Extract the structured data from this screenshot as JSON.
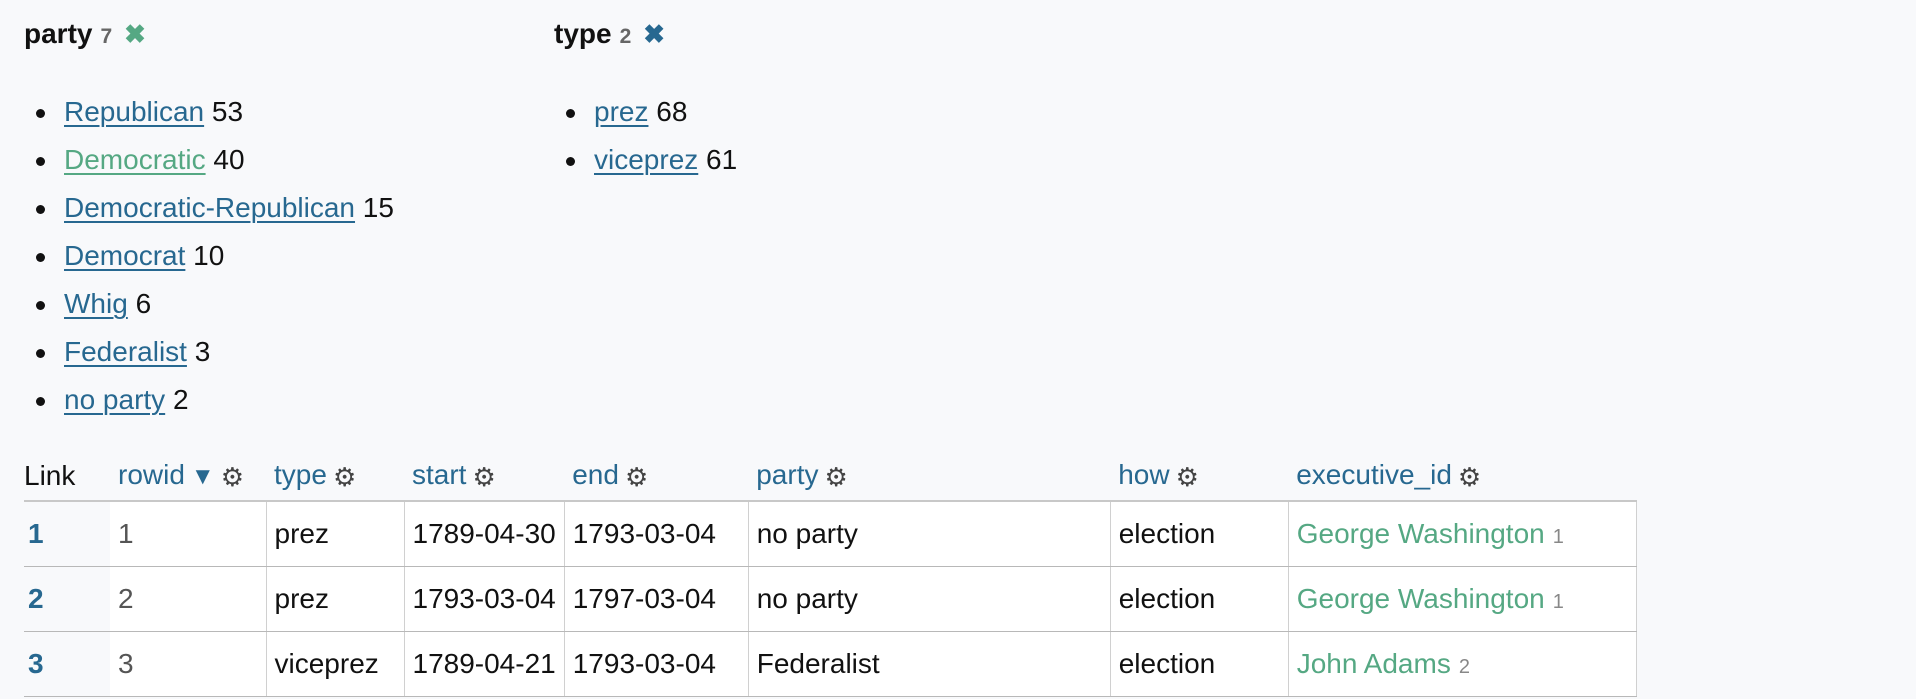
{
  "facets": [
    {
      "name": "party",
      "count": "7",
      "close_icon": "close-x-icon",
      "close_color": "#55a883",
      "items": [
        {
          "label": "Republican",
          "count": "53"
        },
        {
          "label": "Democratic",
          "count": "40"
        },
        {
          "label": "Democratic-Republican",
          "count": "15"
        },
        {
          "label": "Democrat",
          "count": "10"
        },
        {
          "label": "Whig",
          "count": "6"
        },
        {
          "label": "Federalist",
          "count": "3"
        },
        {
          "label": "no party",
          "count": "2"
        }
      ]
    },
    {
      "name": "type",
      "count": "2",
      "close_icon": "close-x-icon",
      "close_color": "#276890",
      "items": [
        {
          "label": "prez",
          "count": "68"
        },
        {
          "label": "viceprez",
          "count": "61"
        }
      ]
    }
  ],
  "table": {
    "headers": {
      "link": "Link",
      "rowid": "rowid",
      "sort_indicator": "▼",
      "type": "type",
      "start": "start",
      "end": "end",
      "party": "party",
      "how": "how",
      "executive_id": "executive_id"
    },
    "rows": [
      {
        "link": "1",
        "rowid": "1",
        "type": "prez",
        "start": "1789-04-30",
        "end": "1793-03-04",
        "party": "no party",
        "how": "election",
        "executive_name": "George Washington",
        "executive_id": "1"
      },
      {
        "link": "2",
        "rowid": "2",
        "type": "prez",
        "start": "1793-03-04",
        "end": "1797-03-04",
        "party": "no party",
        "how": "election",
        "executive_name": "George Washington",
        "executive_id": "1"
      },
      {
        "link": "3",
        "rowid": "3",
        "type": "viceprez",
        "start": "1789-04-21",
        "end": "1793-03-04",
        "party": "Federalist",
        "how": "election",
        "executive_name": "John Adams",
        "executive_id": "2"
      }
    ]
  },
  "colors": {
    "link_blue": "#276890",
    "link_green": "#55a883"
  }
}
